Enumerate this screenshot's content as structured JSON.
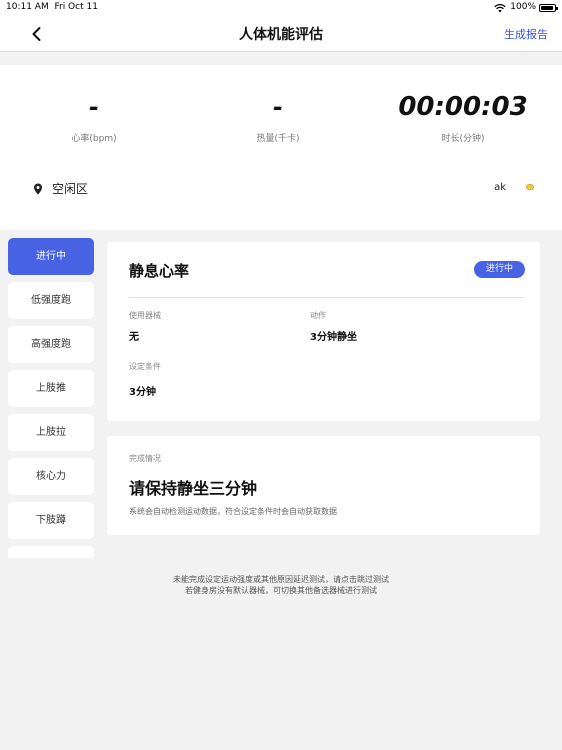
{
  "status_bar": {
    "time": "10:11 AM",
    "date": "Fri Oct 11",
    "battery": "100%"
  },
  "nav": {
    "title": "人体机能评估",
    "report_label": "生成报告"
  },
  "stats": {
    "heart_rate": {
      "value": "-",
      "label": "心率(bpm)"
    },
    "calories": {
      "value": "-",
      "label": "热量(千卡)"
    },
    "duration": {
      "value": "00:00:03",
      "label": "时长(分钟)"
    }
  },
  "location": "空闲区",
  "user": "ak",
  "menu": [
    {
      "label": "进行中",
      "active": true
    },
    {
      "label": "低强度跑",
      "active": false
    },
    {
      "label": "高强度跑",
      "active": false
    },
    {
      "label": "上肢推",
      "active": false
    },
    {
      "label": "上肢拉",
      "active": false
    },
    {
      "label": "核心力",
      "active": false
    },
    {
      "label": "下肢蹲",
      "active": false
    },
    {
      "label": "",
      "active": false
    }
  ],
  "test": {
    "title": "静息心率",
    "status": "进行中",
    "equipment_label": "使用器械",
    "equipment_value": "无",
    "action_label": "动作",
    "action_value": "3分钟静坐",
    "condition_label": "设定条件",
    "condition_value": "3分钟"
  },
  "completion": {
    "label": "完成情况",
    "title": "请保持静坐三分钟",
    "desc": "系统会自动检测运动数据，符合设定条件时会自动获取数据"
  },
  "footer": {
    "line1": "未能完成设定运动强度或其他原因延迟测试，请点击跳过测试",
    "line2": "若健身房没有默认器械，可切换其他备选器械进行测试"
  },
  "colors": {
    "accent": "#4763e3",
    "link": "#3b55d9"
  }
}
